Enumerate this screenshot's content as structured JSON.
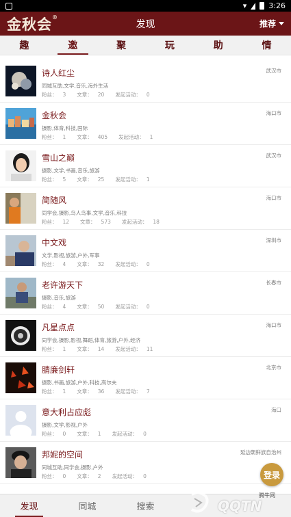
{
  "status_bar": {
    "time": "3:26"
  },
  "header": {
    "logo": "金秋会",
    "logo_mark": "®",
    "title": "发现",
    "recommend": "推荐"
  },
  "tabs": [
    {
      "label": "趣"
    },
    {
      "label": "邀"
    },
    {
      "label": "聚"
    },
    {
      "label": "玩"
    },
    {
      "label": "助"
    },
    {
      "label": "情"
    }
  ],
  "labels": {
    "fans": "粉丝：",
    "articles": "文章：",
    "activities": "发起活动："
  },
  "users": [
    {
      "name": "诗人红尘",
      "tags": "同城互助,文学,音乐,海外生活",
      "fans": "3",
      "articles": "20",
      "activities": "0",
      "city": "武汉市"
    },
    {
      "name": "金秋会",
      "tags": "摄影,体育,科技,国际",
      "fans": "1",
      "articles": "405",
      "activities": "1",
      "city": "海口市"
    },
    {
      "name": "雪山之巅",
      "tags": "摄影,文学,书画,音乐,旅游",
      "fans": "5",
      "articles": "25",
      "activities": "1",
      "city": "武汉市"
    },
    {
      "name": "简随风",
      "tags": "同学会,摄影,鸟人鸟事,文学,音乐,科技",
      "fans": "12",
      "articles": "573",
      "activities": "18",
      "city": "海口市"
    },
    {
      "name": "中文戏",
      "tags": "文学,影视,旅游,户外,军事",
      "fans": "4",
      "articles": "32",
      "activities": "0",
      "city": "深圳市"
    },
    {
      "name": "老许游天下",
      "tags": "摄影,音乐,旅游",
      "fans": "4",
      "articles": "50",
      "activities": "0",
      "city": "长春市"
    },
    {
      "name": "凡星点点",
      "tags": "同学会,摄影,影视,舞蹈,体育,旅游,户外,经济",
      "fans": "1",
      "articles": "14",
      "activities": "11",
      "city": "海口市"
    },
    {
      "name": "腈廉剑轩",
      "tags": "摄影,书画,旅游,户外,科技,高尔夫",
      "fans": "1",
      "articles": "36",
      "activities": "7",
      "city": "北京市"
    },
    {
      "name": "意大利占应彪",
      "tags": "摄影,文学,影视,户外",
      "fans": "0",
      "articles": "1",
      "activities": "0",
      "city": "海口"
    },
    {
      "name": "邦妮的空间",
      "tags": "同城互助,同学会,摄影,户外",
      "fans": "0",
      "articles": "2",
      "activities": "0",
      "city": "延边朝鲜族自治州"
    }
  ],
  "login_button": "登录",
  "bottom_nav": [
    {
      "label": "发现"
    },
    {
      "label": "同城"
    },
    {
      "label": "搜索"
    }
  ],
  "watermark": {
    "text": "QQTN",
    "small": "腾牛网"
  },
  "colors": {
    "brand": "#6b1517",
    "accent": "#c99a3e"
  }
}
